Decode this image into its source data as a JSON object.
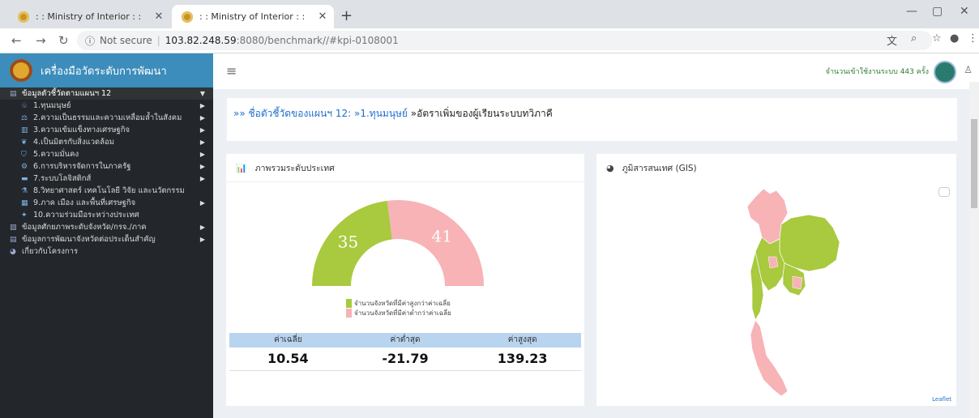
{
  "browser": {
    "tabs": [
      {
        "title": ": : Ministry of Interior : :"
      },
      {
        "title": ": : Ministry of Interior : :"
      }
    ],
    "url_security": "Not secure",
    "url_host": "103.82.248.59",
    "url_path": ":8080/benchmark//#kpi-0108001"
  },
  "sidebar": {
    "brand": "เครื่องมือวัดระดับการพัฒนา",
    "items": [
      {
        "label": "ข้อมูลตัวชี้วัดตามแผนฯ 12",
        "level": 0,
        "icon": "document-icon"
      },
      {
        "label": "1.ทุนมนุษย์",
        "level": 1,
        "icon": "people-icon"
      },
      {
        "label": "2.ความเป็นธรรมและความเหลื่อมล้ำในสังคม",
        "level": 1,
        "icon": "balance-icon"
      },
      {
        "label": "3.ความเข้มแข็งทางเศรษฐกิจ",
        "level": 1,
        "icon": "bars-icon"
      },
      {
        "label": "4.เป็นมิตรกับสิ่งแวดล้อม",
        "level": 1,
        "icon": "leaf-icon"
      },
      {
        "label": "5.ความมั่นคง",
        "level": 1,
        "icon": "shield-icon"
      },
      {
        "label": "6.การบริหารจัดการในภาครัฐ",
        "level": 1,
        "icon": "gear-icon"
      },
      {
        "label": "7.ระบบโลจิสติกส์",
        "level": 1,
        "icon": "truck-icon"
      },
      {
        "label": "8.วิทยาศาสตร์ เทคโนโลยี วิจัย และนวัตกรรม",
        "level": 1,
        "icon": "flask-icon"
      },
      {
        "label": "9.ภาค เมือง และพื้นที่เศรษฐกิจ",
        "level": 1,
        "icon": "city-icon"
      },
      {
        "label": "10.ความร่วมมือระหว่างประเทศ",
        "level": 1,
        "icon": "handshake-icon"
      },
      {
        "label": "ข้อมูลศักยภาพระดับจังหวัด/กรจ./ภาค",
        "level": 0,
        "icon": "chart-icon"
      },
      {
        "label": "ข้อมูลการพัฒนาจังหวัดต่อประเด็นสำคัญ",
        "level": 0,
        "icon": "document-icon"
      },
      {
        "label": "เกี่ยวกับโครงการ",
        "level": 0,
        "icon": "globe-icon"
      }
    ]
  },
  "topbar": {
    "visitors": "จำนวนเข้าใช้งานระบบ 443 ครั้ง"
  },
  "title": {
    "prefix": "»» ชื่อตัวชี้วัดของแผนฯ 12:",
    "crumb1": "»1.ทุนมนุษย์",
    "current": "»อัตราเพิ่มของผู้เรียนระบบทวิภาคี"
  },
  "overview_panel": {
    "heading": "ภาพรวมระดับประเทศ",
    "stats_headers": [
      "ค่าเฉลี่ย",
      "ค่าต่ำสุด",
      "ค่าสูงสุด"
    ],
    "stats_values": [
      "10.54",
      "-21.79",
      "139.23"
    ]
  },
  "gis_panel": {
    "heading": "ภูมิสารสนเทศ (GIS)",
    "attribution": "Leaflet"
  },
  "chart_data": {
    "type": "pie",
    "categories": [
      "จำนวนจังหวัดที่มีค่าสูงกว่าค่าเฉลี่ย",
      "จำนวนจังหวัดที่มีค่าต่ำกว่าค่าเฉลี่ย"
    ],
    "values": [
      35,
      41
    ],
    "colors": [
      "#a9c93e",
      "#f7b3b6"
    ],
    "legend": "bottom"
  }
}
